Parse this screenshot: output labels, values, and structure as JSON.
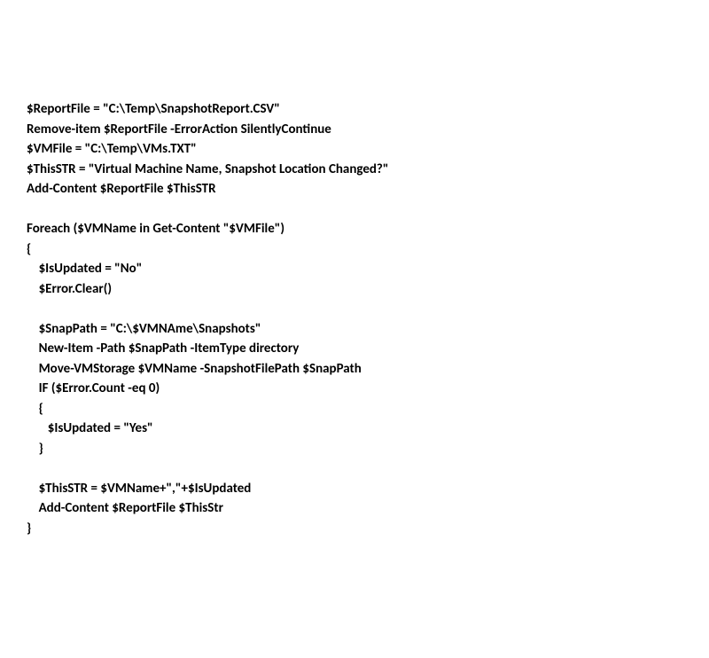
{
  "code": {
    "l1": "$ReportFile = \"C:\\Temp\\SnapshotReport.CSV\"",
    "l2": "Remove-item $ReportFile -ErrorAction SilentlyContinue",
    "l3": "$VMFile = \"C:\\Temp\\VMs.TXT\"",
    "l4": "$ThisSTR = \"Virtual Machine Name, Snapshot Location Changed?\"",
    "l5": "Add-Content $ReportFile $ThisSTR",
    "l6": "",
    "l7": "Foreach ($VMName in Get-Content \"$VMFile\")",
    "l8": "{",
    "l9": "    $IsUpdated = \"No\"",
    "l10": "    $Error.Clear()",
    "l11": "",
    "l12": "    $SnapPath = \"C:\\$VMNAme\\Snapshots\"",
    "l13": "    New-Item -Path $SnapPath -ItemType directory",
    "l14": "    Move-VMStorage $VMName -SnapshotFilePath $SnapPath",
    "l15": "    IF ($Error.Count -eq 0)",
    "l16": "    {",
    "l17": "       $IsUpdated = \"Yes\"",
    "l18": "    }",
    "l19": "",
    "l20": "    $ThisSTR = $VMName+\",\"+$IsUpdated",
    "l21": "    Add-Content $ReportFile $ThisStr",
    "l22": "}"
  }
}
